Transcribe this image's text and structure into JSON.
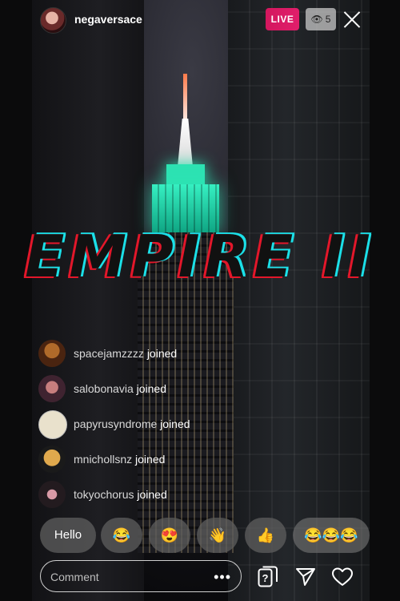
{
  "header": {
    "username": "negaversace",
    "live_label": "LIVE",
    "viewer_count": "5"
  },
  "overlay": {
    "title": "EMPIRE II"
  },
  "comments": [
    {
      "user": "spacejamzzzz",
      "action": "joined"
    },
    {
      "user": "salobonavia",
      "action": "joined"
    },
    {
      "user": "papyrusyndrome",
      "action": "joined"
    },
    {
      "user": "mnichollsnz",
      "action": "joined"
    },
    {
      "user": "tokyochorus",
      "action": "joined"
    }
  ],
  "quick_reactions": [
    {
      "label": "Hello"
    },
    {
      "label": "😂"
    },
    {
      "label": "😍"
    },
    {
      "label": "👋"
    },
    {
      "label": "👍"
    },
    {
      "label": "😂😂😂"
    }
  ],
  "footer": {
    "comment_placeholder": "Comment",
    "more_label": "•••"
  },
  "colors": {
    "live_badge": "#e11e6b",
    "building_light": "#2de3b3",
    "title_red": "#e3172a",
    "title_cyan": "#1be0e8"
  }
}
